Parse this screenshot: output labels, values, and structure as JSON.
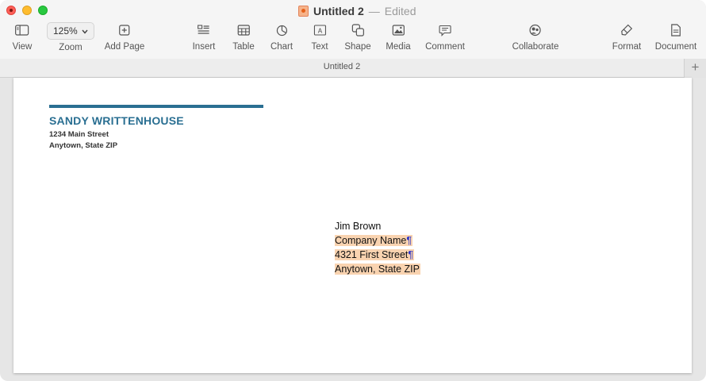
{
  "window": {
    "title": "Untitled 2",
    "title_separator": "—",
    "status": "Edited",
    "tab_title": "Untitled 2",
    "new_tab_symbol": "+"
  },
  "toolbar": {
    "view_label": "View",
    "zoom_value": "125%",
    "zoom_label": "Zoom",
    "add_page_label": "Add Page",
    "insert_label": "Insert",
    "table_label": "Table",
    "chart_label": "Chart",
    "text_label": "Text",
    "shape_label": "Shape",
    "media_label": "Media",
    "comment_label": "Comment",
    "collaborate_label": "Collaborate",
    "format_label": "Format",
    "document_label": "Document",
    "icons": [
      "sidebar-icon",
      "chevron-down-icon",
      "add-page-icon",
      "insert-icon",
      "table-icon",
      "chart-icon",
      "text-box-icon",
      "shape-icon",
      "media-icon",
      "comment-icon",
      "collaborate-icon",
      "format-brush-icon",
      "document-icon"
    ]
  },
  "document": {
    "sender": {
      "name": "SANDY WRITTENHOUSE",
      "street": "1234 Main Street",
      "city_line": "Anytown, State ZIP"
    },
    "recipient": {
      "name": "Jim Brown",
      "company": "Company Name",
      "street": "4321 First Street",
      "city_line": "Anytown, State ZIP"
    },
    "paragraph_mark": "¶"
  },
  "colors": {
    "accent": "#2a6f92",
    "selection_highlight": "#f9d3b0",
    "pilcrow": "#2c35c9"
  }
}
